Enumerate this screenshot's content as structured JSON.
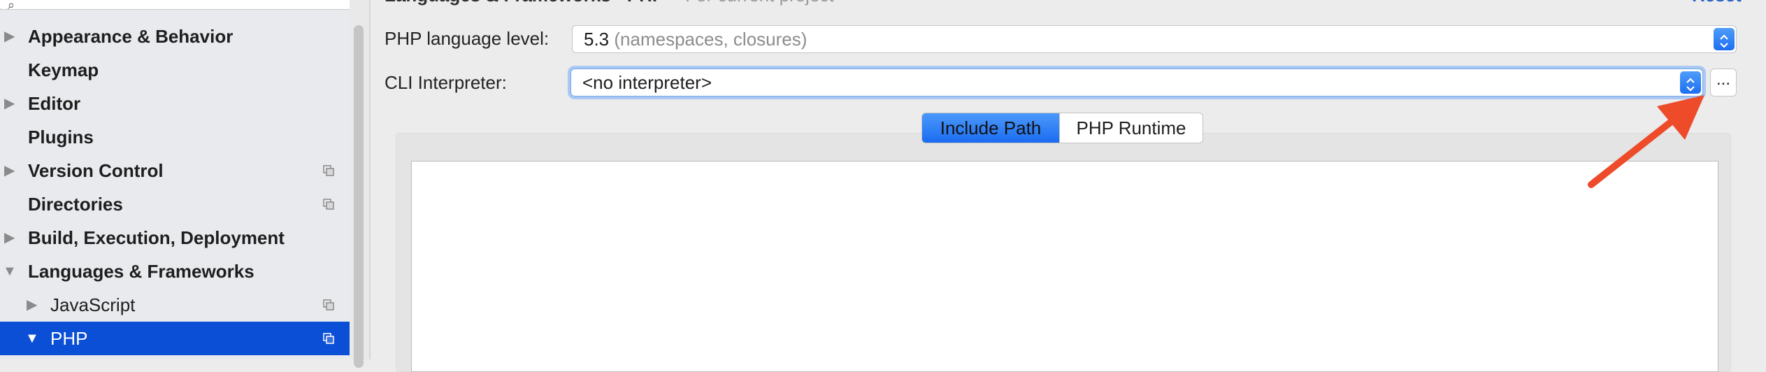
{
  "header": {
    "breadcrumb_title": "Languages & Frameworks  ›  PHP",
    "breadcrumb_scope": "For current project",
    "reset_label": "Reset"
  },
  "sidebar": {
    "items": [
      {
        "label": "Appearance & Behavior"
      },
      {
        "label": "Keymap"
      },
      {
        "label": "Editor"
      },
      {
        "label": "Plugins"
      },
      {
        "label": "Version Control"
      },
      {
        "label": "Directories"
      },
      {
        "label": "Build, Execution, Deployment"
      },
      {
        "label": "Languages & Frameworks"
      },
      {
        "label": "JavaScript"
      },
      {
        "label": "PHP"
      }
    ],
    "arrow_collapsed": "▶",
    "arrow_expanded": "▼"
  },
  "php_settings": {
    "language_level_label": "PHP language level:",
    "language_level_value": "5.3",
    "language_level_hint": "(namespaces, closures)",
    "cli_label": "CLI Interpreter:",
    "cli_value": "<no interpreter>",
    "more_button_label": "..."
  },
  "tabs": [
    {
      "label": "Include Path",
      "active": true
    },
    {
      "label": "PHP Runtime",
      "active": false
    }
  ],
  "colors": {
    "selection": "#0b4fd6",
    "accent_blue": "#1d6ef0",
    "annotation_arrow": "#ee4b2b"
  },
  "icons": {
    "project_scope_icon": "copy-icon",
    "annotation": "red-pointer-arrow"
  }
}
